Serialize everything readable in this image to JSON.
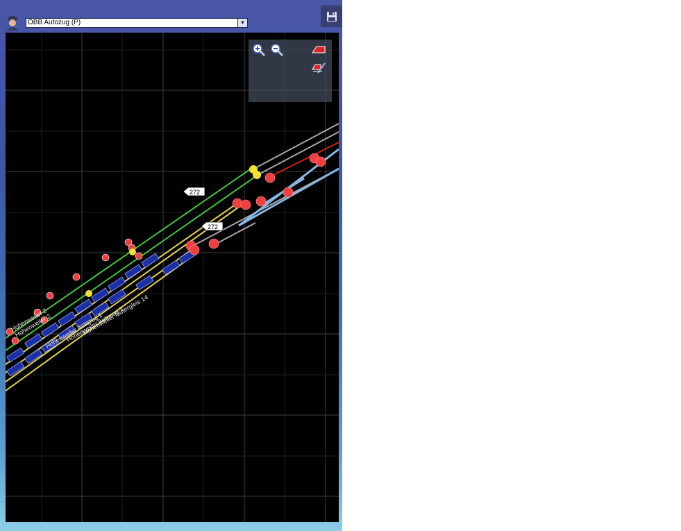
{
  "train_selector": {
    "selected": "ÖBB Autozug (P)"
  },
  "map": {
    "markers": [
      {
        "label": "272"
      },
      {
        "label": "272"
      }
    ],
    "track_labels": [
      "Hohenweiler 2",
      "Hohenweiler 2",
      "Hohenweiler Autozug 1",
      "Hohenweiler Autozug 2",
      "Hohenweiler Gütergleis 14"
    ]
  },
  "icons": {
    "driver": "driver-icon",
    "save": "floppy-disk-icon",
    "zoom_in": "zoom-in-icon",
    "zoom_out": "zoom-out-icon",
    "track_view": "track-view-icon",
    "track_tool": "track-tool-icon"
  },
  "colors": {
    "map_background": "#000000",
    "grid": "#3a3a3a",
    "track_green": "#43c63a",
    "track_yellow": "#e6d34a",
    "track_grey": "#a9a9a9",
    "track_blue": "#86b8e6",
    "track_red": "#d21e1e",
    "signal_red": "#ef4040",
    "signal_yellow": "#f3e233",
    "train_blue": "#1b2fa6"
  }
}
